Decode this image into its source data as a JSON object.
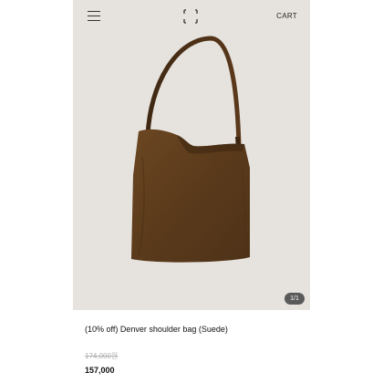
{
  "header": {
    "menu_icon": "hamburger-menu-icon",
    "logo_icon": "bracket-logo-icon",
    "cart_label": "CART"
  },
  "gallery": {
    "counter": "1/1",
    "image": "brown suede shoulder bag"
  },
  "product": {
    "title": "(10% off) Denver shoulder bag (Suede)",
    "original_price": "174,000원",
    "sale_price": "157,000"
  },
  "colors": {
    "hero_background": "#e6e3de",
    "bag_suede": "#5e3d1c",
    "strap_leather": "#4a2f17"
  }
}
